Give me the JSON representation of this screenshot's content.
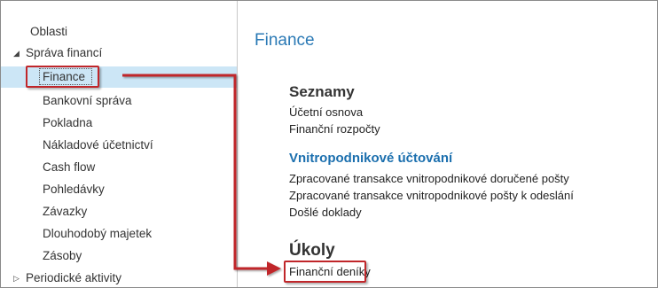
{
  "nav": {
    "areas_label": "Oblasti",
    "section_label": "Správa financí",
    "section_expand_icon": "triangle-expanded",
    "items": [
      {
        "label": "Finance",
        "selected": true
      },
      {
        "label": "Bankovní správa"
      },
      {
        "label": "Pokladna"
      },
      {
        "label": "Nákladové účetnictví"
      },
      {
        "label": "Cash flow"
      },
      {
        "label": "Pohledávky"
      },
      {
        "label": "Závazky"
      },
      {
        "label": "Dlouhodobý majetek"
      },
      {
        "label": "Zásoby"
      }
    ],
    "collapsed_label": "Periodické aktivity",
    "collapsed_icon": "triangle-collapsed"
  },
  "main": {
    "title": "Finance",
    "groups": {
      "lists": {
        "title": "Seznamy",
        "links": [
          "Účetní osnova",
          "Finanční rozpočty"
        ]
      },
      "intercompany": {
        "title": "Vnitropodnikové účtování",
        "links": [
          "Zpracované transakce vnitropodnikové doručené pošty",
          "Zpracované transakce vnitropodnikové pošty k odeslání",
          "Došlé doklady"
        ]
      },
      "tasks": {
        "title": "Úkoly",
        "links": [
          "Finanční deníky"
        ]
      }
    }
  },
  "colors": {
    "accent": "#2a79b5",
    "selection": "#cce6f6",
    "annotation": "#c0262a"
  }
}
